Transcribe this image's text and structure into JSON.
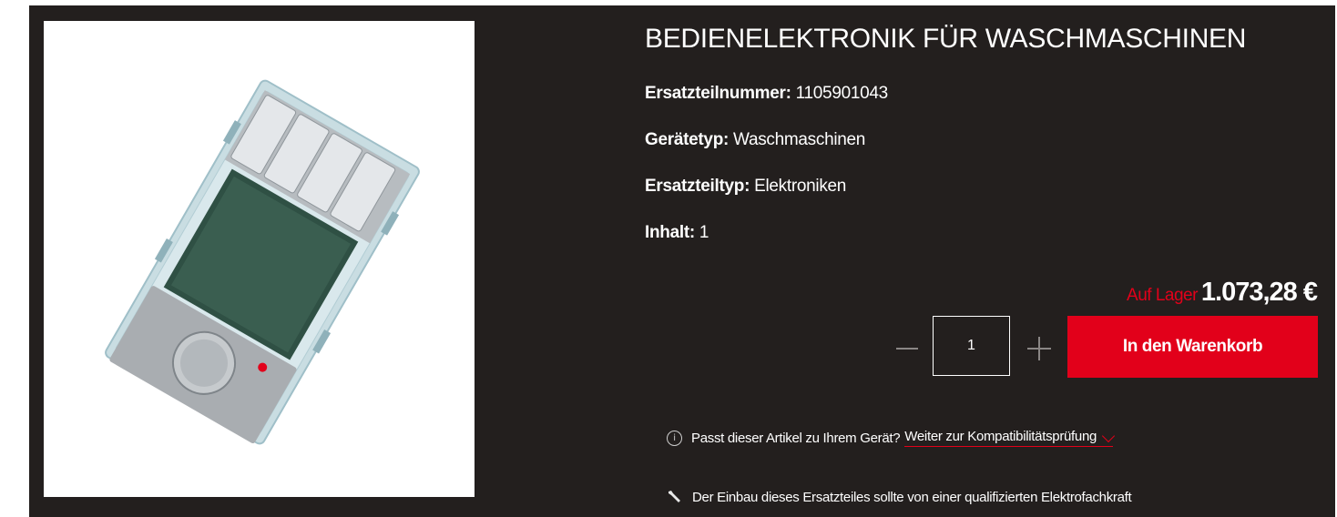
{
  "product": {
    "title": "BEDIENELEKTRONIK FÜR WASCHMASCHINEN",
    "specs": [
      {
        "key": "Ersatzteilnummer:",
        "value": "1105901043"
      },
      {
        "key": "Gerätetyp:",
        "value": "Waschmaschinen"
      },
      {
        "key": "Ersatzteiltyp:",
        "value": "Elektroniken"
      },
      {
        "key": "Inhalt:",
        "value": "1"
      }
    ],
    "stock_label": "Auf Lager",
    "price": "1.073,28 €",
    "quantity": "1",
    "cart_button": "In den Warenkorb",
    "compat_question": "Passt dieser Artikel zu Ihrem Gerät?",
    "compat_link": "Weiter zur Kompatibilitätsprüfung",
    "install_note": "Der Einbau dieses Ersatzteiles sollte von einer qualifizierten Elektrofachkraft"
  },
  "icons": {
    "quantity_decrease": "minus-icon",
    "quantity_increase": "plus-icon",
    "info": "info-icon",
    "compat_expand": "chevron-down-icon",
    "install": "wrench-icon"
  },
  "colors": {
    "background": "#231f1e",
    "accent": "#e2001a",
    "text": "#ffffff"
  }
}
